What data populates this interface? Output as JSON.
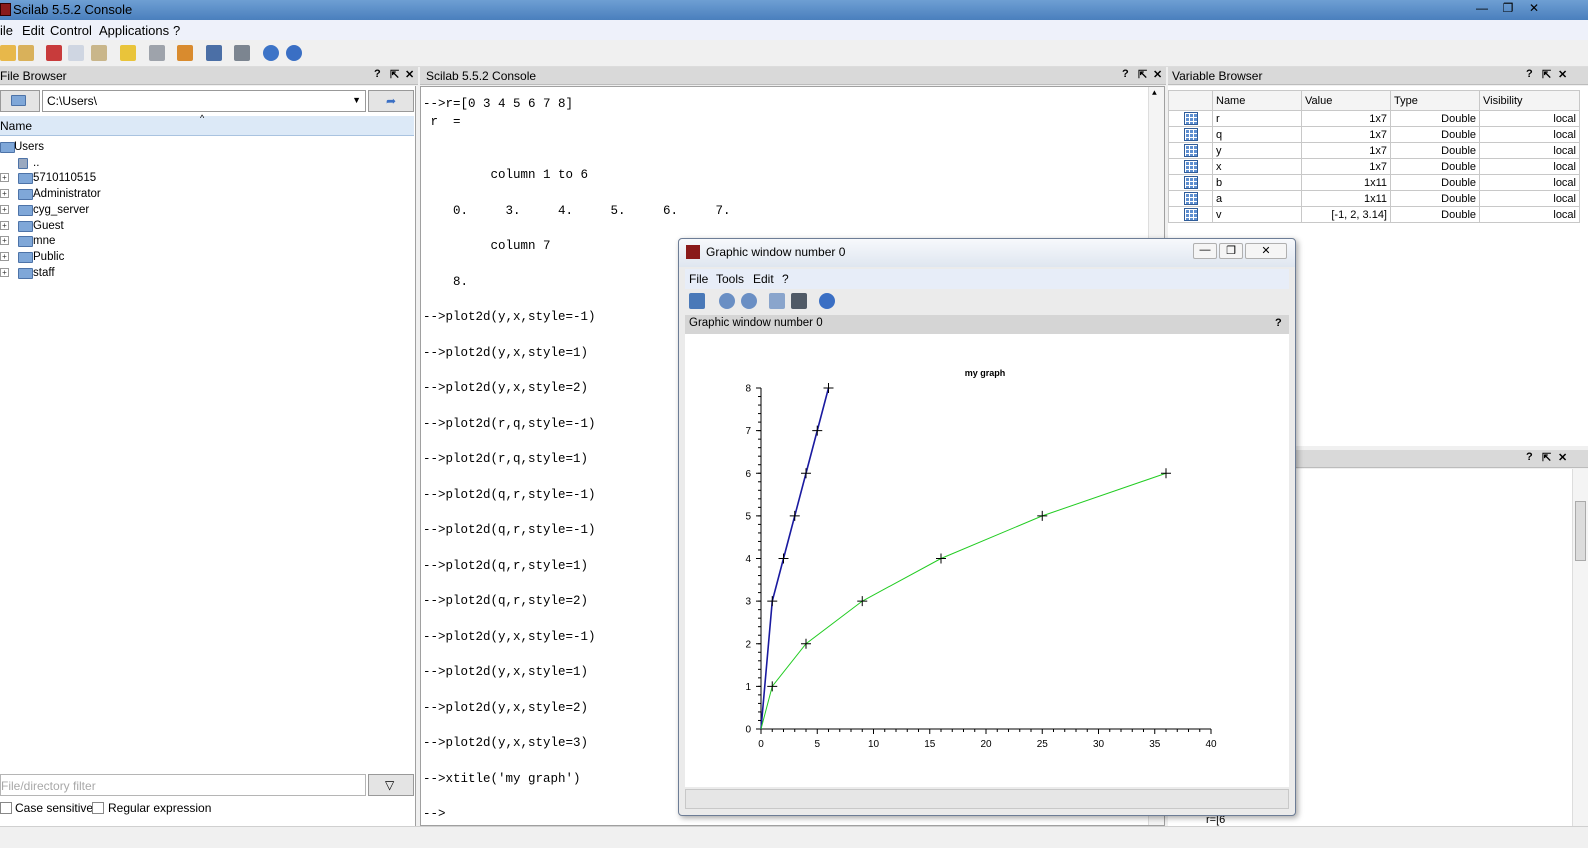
{
  "window": {
    "title": "Scilab 5.5.2 Console",
    "min": "—",
    "max": "❐",
    "close": "✕"
  },
  "menu": [
    "ile",
    "Edit",
    "Control",
    "Applications",
    "?"
  ],
  "file_browser": {
    "header": "File Browser",
    "path": "C:\\Users\\",
    "column": "Name",
    "tree": [
      {
        "label": "Users",
        "level": 0,
        "expander": false
      },
      {
        "label": "..",
        "level": 1,
        "expander": false
      },
      {
        "label": "5710110515",
        "level": 1,
        "expander": true
      },
      {
        "label": "Administrator",
        "level": 1,
        "expander": true
      },
      {
        "label": "cyg_server",
        "level": 1,
        "expander": true
      },
      {
        "label": "Guest",
        "level": 1,
        "expander": true
      },
      {
        "label": "mne",
        "level": 1,
        "expander": true
      },
      {
        "label": "Public",
        "level": 1,
        "expander": true
      },
      {
        "label": "staff",
        "level": 1,
        "expander": true
      }
    ],
    "filter_placeholder": "File/directory filter",
    "case_sensitive": "Case sensitive",
    "regex": "Regular expression"
  },
  "console": {
    "header": "Scilab 5.5.2 Console",
    "lines": [
      "-->r=[0 3 4 5 6 7 8]",
      " r  =",
      "",
      "",
      "         column 1 to 6",
      "",
      "    0.     3.     4.     5.     6.     7.",
      "",
      "         column 7",
      "",
      "    8.",
      "",
      "-->plot2d(y,x,style=-1)",
      "",
      "-->plot2d(y,x,style=1)",
      "",
      "-->plot2d(y,x,style=2)",
      "",
      "-->plot2d(r,q,style=-1)",
      "",
      "-->plot2d(r,q,style=1)",
      "",
      "-->plot2d(q,r,style=-1)",
      "",
      "-->plot2d(q,r,style=-1)",
      "",
      "-->plot2d(q,r,style=1)",
      "",
      "-->plot2d(q,r,style=2)",
      "",
      "-->plot2d(y,x,style=-1)",
      "",
      "-->plot2d(y,x,style=1)",
      "",
      "-->plot2d(y,x,style=2)",
      "",
      "-->plot2d(y,x,style=3)",
      "",
      "-->xtitle('my graph')",
      "",
      "-->"
    ]
  },
  "variable_browser": {
    "header": "Variable Browser",
    "columns": [
      "Name",
      "Value",
      "Type",
      "Visibility"
    ],
    "rows": [
      {
        "name": "r",
        "value": "1x7",
        "type": "Double",
        "visibility": "local"
      },
      {
        "name": "q",
        "value": "1x7",
        "type": "Double",
        "visibility": "local"
      },
      {
        "name": "y",
        "value": "1x7",
        "type": "Double",
        "visibility": "local"
      },
      {
        "name": "x",
        "value": "1x7",
        "type": "Double",
        "visibility": "local"
      },
      {
        "name": "b",
        "value": "1x11",
        "type": "Double",
        "visibility": "local"
      },
      {
        "name": "a",
        "value": "1x11",
        "type": "Double",
        "visibility": "local"
      },
      {
        "name": "v",
        "value": "[-1, 2, 3.14]",
        "type": "Double",
        "visibility": "local"
      }
    ]
  },
  "history": {
    "partial_line": "r=[6"
  },
  "graphic_window": {
    "title": "Graphic window number 0",
    "menu": [
      "File",
      "Tools",
      "Edit",
      "?"
    ],
    "subheader": "Graphic window number 0",
    "help": "?"
  },
  "chart_data": {
    "type": "line",
    "title": "my graph",
    "xlim": [
      0,
      40
    ],
    "ylim": [
      0,
      8
    ],
    "xticks": [
      0,
      5,
      10,
      15,
      20,
      25,
      30,
      35,
      40
    ],
    "yticks": [
      0,
      1,
      2,
      3,
      4,
      5,
      6,
      7,
      8
    ],
    "series": [
      {
        "color": "#1a1aa0",
        "x": [
          0,
          1,
          2,
          3,
          4,
          5,
          6
        ],
        "y": [
          0,
          3,
          4,
          5,
          6,
          7,
          8
        ],
        "markers": true
      },
      {
        "color": "#22cc22",
        "x": [
          0,
          1,
          4,
          9,
          16,
          25,
          36
        ],
        "y": [
          0,
          1,
          2,
          3,
          4,
          5,
          6
        ],
        "markers": true
      }
    ],
    "grid": false
  }
}
